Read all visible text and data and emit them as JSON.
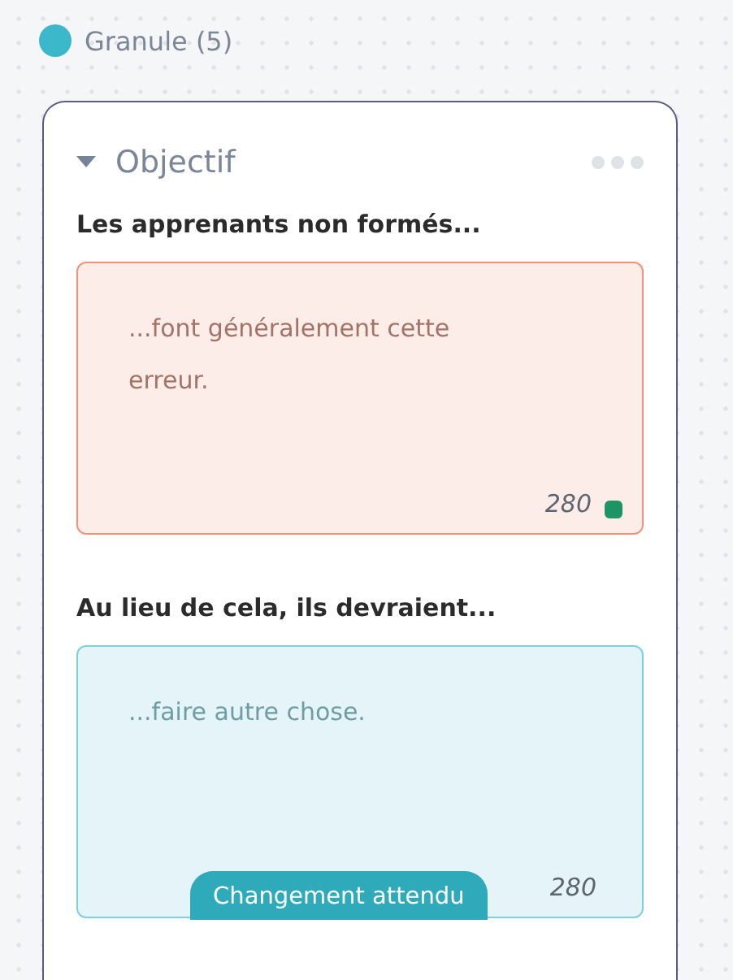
{
  "group": {
    "label": "Granule (5)",
    "color": "#3bb8c9"
  },
  "card": {
    "title": "Objectif",
    "expanded": true,
    "fields": [
      {
        "kind": "mistake",
        "label": "Les apprenants non formés...",
        "placeholder": "...font généralement cette erreur.",
        "counter": "280",
        "color": "#1e9464"
      },
      {
        "kind": "change",
        "label": "Au lieu de cela, ils devraient...",
        "placeholder": "...faire autre chose.",
        "counter": "280",
        "tag": "Changement attendu"
      }
    ]
  }
}
